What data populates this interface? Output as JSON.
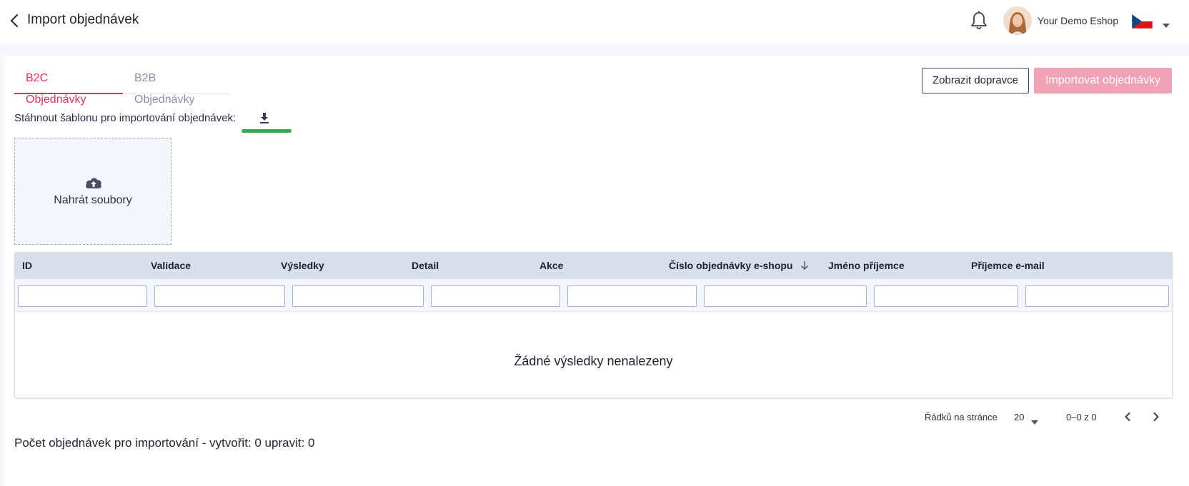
{
  "header": {
    "title": "Import objednávek",
    "shop_name": "Your Demo Eshop",
    "icons": {
      "back": "chevron-left-icon",
      "notifications": "bell-icon",
      "language": "czech-flag-icon"
    }
  },
  "tabs": [
    {
      "label": "B2C Objednávky",
      "active": true
    },
    {
      "label": "B2B Objednávky",
      "active": false
    }
  ],
  "actions": {
    "show_carriers": "Zobrazit dopravce",
    "import_orders": "Importovat objednávky"
  },
  "template": {
    "label": "Stáhnout šablonu pro importování objednávek:"
  },
  "upload": {
    "label": "Nahrát soubory"
  },
  "table": {
    "columns": [
      "ID",
      "Validace",
      "Výsledky",
      "Detail",
      "Akce",
      "Číslo objednávky e-shopu",
      "Jméno příjemce",
      "Příjemce e-mail"
    ],
    "sorted_column": "Číslo objednávky e-shopu",
    "sort_direction": "descending",
    "empty_message": "Žádné výsledky nenalezeny",
    "filters": [
      "",
      "",
      "",
      "",
      "",
      "",
      "",
      ""
    ]
  },
  "pagination": {
    "rows_label": "Řádků na stránce",
    "rows_value": "20",
    "range": "0–0 z 0"
  },
  "summary": "Počet objednávek pro importování - vytvořit: 0 upravit: 0",
  "colors": {
    "accent": "#e0315f",
    "import_button_disabled": "#f2a2b6",
    "table_header": "#d8deec",
    "highlight": "#2eae4f"
  }
}
